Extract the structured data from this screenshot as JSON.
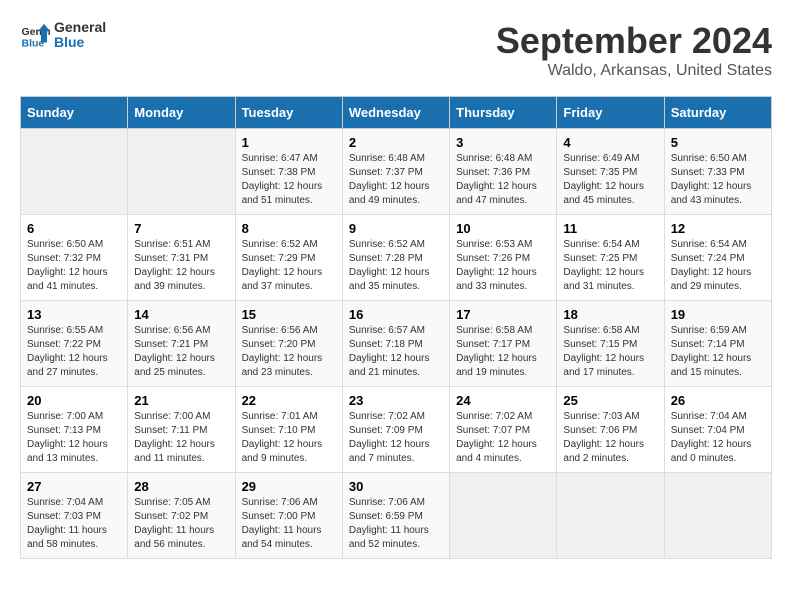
{
  "logo": {
    "line1": "General",
    "line2": "Blue"
  },
  "title": "September 2024",
  "subtitle": "Waldo, Arkansas, United States",
  "weekdays": [
    "Sunday",
    "Monday",
    "Tuesday",
    "Wednesday",
    "Thursday",
    "Friday",
    "Saturday"
  ],
  "days": [
    null,
    null,
    {
      "num": "1",
      "sunrise": "Sunrise: 6:47 AM",
      "sunset": "Sunset: 7:38 PM",
      "daylight": "Daylight: 12 hours and 51 minutes."
    },
    {
      "num": "2",
      "sunrise": "Sunrise: 6:48 AM",
      "sunset": "Sunset: 7:37 PM",
      "daylight": "Daylight: 12 hours and 49 minutes."
    },
    {
      "num": "3",
      "sunrise": "Sunrise: 6:48 AM",
      "sunset": "Sunset: 7:36 PM",
      "daylight": "Daylight: 12 hours and 47 minutes."
    },
    {
      "num": "4",
      "sunrise": "Sunrise: 6:49 AM",
      "sunset": "Sunset: 7:35 PM",
      "daylight": "Daylight: 12 hours and 45 minutes."
    },
    {
      "num": "5",
      "sunrise": "Sunrise: 6:50 AM",
      "sunset": "Sunset: 7:33 PM",
      "daylight": "Daylight: 12 hours and 43 minutes."
    },
    {
      "num": "6",
      "sunrise": "Sunrise: 6:50 AM",
      "sunset": "Sunset: 7:32 PM",
      "daylight": "Daylight: 12 hours and 41 minutes."
    },
    {
      "num": "7",
      "sunrise": "Sunrise: 6:51 AM",
      "sunset": "Sunset: 7:31 PM",
      "daylight": "Daylight: 12 hours and 39 minutes."
    },
    {
      "num": "8",
      "sunrise": "Sunrise: 6:52 AM",
      "sunset": "Sunset: 7:29 PM",
      "daylight": "Daylight: 12 hours and 37 minutes."
    },
    {
      "num": "9",
      "sunrise": "Sunrise: 6:52 AM",
      "sunset": "Sunset: 7:28 PM",
      "daylight": "Daylight: 12 hours and 35 minutes."
    },
    {
      "num": "10",
      "sunrise": "Sunrise: 6:53 AM",
      "sunset": "Sunset: 7:26 PM",
      "daylight": "Daylight: 12 hours and 33 minutes."
    },
    {
      "num": "11",
      "sunrise": "Sunrise: 6:54 AM",
      "sunset": "Sunset: 7:25 PM",
      "daylight": "Daylight: 12 hours and 31 minutes."
    },
    {
      "num": "12",
      "sunrise": "Sunrise: 6:54 AM",
      "sunset": "Sunset: 7:24 PM",
      "daylight": "Daylight: 12 hours and 29 minutes."
    },
    {
      "num": "13",
      "sunrise": "Sunrise: 6:55 AM",
      "sunset": "Sunset: 7:22 PM",
      "daylight": "Daylight: 12 hours and 27 minutes."
    },
    {
      "num": "14",
      "sunrise": "Sunrise: 6:56 AM",
      "sunset": "Sunset: 7:21 PM",
      "daylight": "Daylight: 12 hours and 25 minutes."
    },
    {
      "num": "15",
      "sunrise": "Sunrise: 6:56 AM",
      "sunset": "Sunset: 7:20 PM",
      "daylight": "Daylight: 12 hours and 23 minutes."
    },
    {
      "num": "16",
      "sunrise": "Sunrise: 6:57 AM",
      "sunset": "Sunset: 7:18 PM",
      "daylight": "Daylight: 12 hours and 21 minutes."
    },
    {
      "num": "17",
      "sunrise": "Sunrise: 6:58 AM",
      "sunset": "Sunset: 7:17 PM",
      "daylight": "Daylight: 12 hours and 19 minutes."
    },
    {
      "num": "18",
      "sunrise": "Sunrise: 6:58 AM",
      "sunset": "Sunset: 7:15 PM",
      "daylight": "Daylight: 12 hours and 17 minutes."
    },
    {
      "num": "19",
      "sunrise": "Sunrise: 6:59 AM",
      "sunset": "Sunset: 7:14 PM",
      "daylight": "Daylight: 12 hours and 15 minutes."
    },
    {
      "num": "20",
      "sunrise": "Sunrise: 7:00 AM",
      "sunset": "Sunset: 7:13 PM",
      "daylight": "Daylight: 12 hours and 13 minutes."
    },
    {
      "num": "21",
      "sunrise": "Sunrise: 7:00 AM",
      "sunset": "Sunset: 7:11 PM",
      "daylight": "Daylight: 12 hours and 11 minutes."
    },
    {
      "num": "22",
      "sunrise": "Sunrise: 7:01 AM",
      "sunset": "Sunset: 7:10 PM",
      "daylight": "Daylight: 12 hours and 9 minutes."
    },
    {
      "num": "23",
      "sunrise": "Sunrise: 7:02 AM",
      "sunset": "Sunset: 7:09 PM",
      "daylight": "Daylight: 12 hours and 7 minutes."
    },
    {
      "num": "24",
      "sunrise": "Sunrise: 7:02 AM",
      "sunset": "Sunset: 7:07 PM",
      "daylight": "Daylight: 12 hours and 4 minutes."
    },
    {
      "num": "25",
      "sunrise": "Sunrise: 7:03 AM",
      "sunset": "Sunset: 7:06 PM",
      "daylight": "Daylight: 12 hours and 2 minutes."
    },
    {
      "num": "26",
      "sunrise": "Sunrise: 7:04 AM",
      "sunset": "Sunset: 7:04 PM",
      "daylight": "Daylight: 12 hours and 0 minutes."
    },
    {
      "num": "27",
      "sunrise": "Sunrise: 7:04 AM",
      "sunset": "Sunset: 7:03 PM",
      "daylight": "Daylight: 11 hours and 58 minutes."
    },
    {
      "num": "28",
      "sunrise": "Sunrise: 7:05 AM",
      "sunset": "Sunset: 7:02 PM",
      "daylight": "Daylight: 11 hours and 56 minutes."
    },
    {
      "num": "29",
      "sunrise": "Sunrise: 7:06 AM",
      "sunset": "Sunset: 7:00 PM",
      "daylight": "Daylight: 11 hours and 54 minutes."
    },
    {
      "num": "30",
      "sunrise": "Sunrise: 7:06 AM",
      "sunset": "Sunset: 6:59 PM",
      "daylight": "Daylight: 11 hours and 52 minutes."
    }
  ]
}
